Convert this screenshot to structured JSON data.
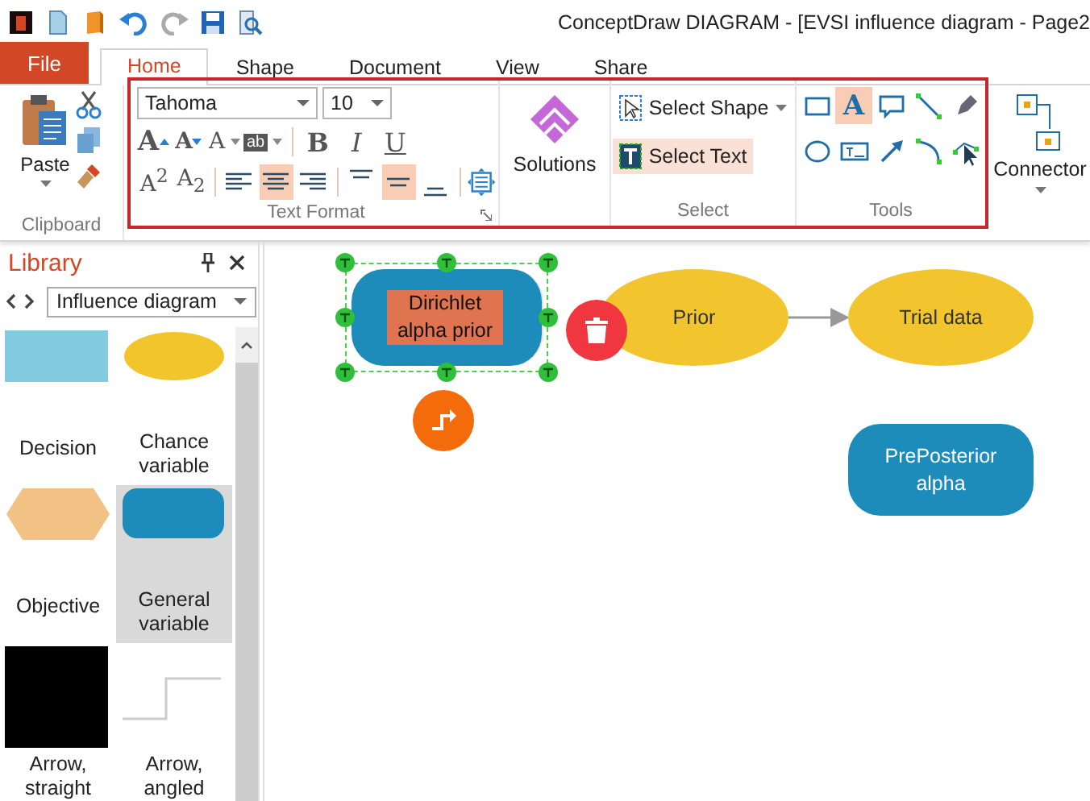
{
  "window": {
    "title": "ConceptDraw DIAGRAM - [EVSI influence diagram - Page2"
  },
  "file_tab": {
    "label": "File"
  },
  "tabs": [
    {
      "label": "Home",
      "selected": true
    },
    {
      "label": "Shape",
      "selected": false
    },
    {
      "label": "Document",
      "selected": false
    },
    {
      "label": "View",
      "selected": false
    },
    {
      "label": "Share",
      "selected": false
    }
  ],
  "ribbon": {
    "clipboard": {
      "paste": "Paste",
      "group_label": "Clipboard"
    },
    "text_format": {
      "font": "Tahoma",
      "size": "10",
      "grow": "A",
      "shrink": "A",
      "font_color": "A",
      "highlight": "ab",
      "styles": [
        {
          "label": "B",
          "kind": "bold"
        },
        {
          "label": "I",
          "kind": "italic"
        },
        {
          "label": "U",
          "kind": "underline"
        }
      ],
      "scripts": [
        "A$^{2}$",
        "A$_{2}$"
      ],
      "h_align": [
        {
          "kind": "left",
          "selected": false
        },
        {
          "kind": "center",
          "selected": true
        },
        {
          "kind": "right",
          "selected": false
        }
      ],
      "v_align": [
        {
          "kind": "top",
          "selected": false
        },
        {
          "kind": "middle",
          "selected": true
        },
        {
          "kind": "bottom",
          "selected": false
        }
      ],
      "group_label": "Text Format"
    },
    "solutions": {
      "label": "Solutions"
    },
    "select": {
      "items": [
        {
          "label": "Select Shape",
          "kind": "shape",
          "selected": false
        },
        {
          "label": "Select Text",
          "kind": "text",
          "selected": true
        }
      ],
      "group_label": "Select"
    },
    "tools": {
      "items": [
        {
          "kind": "rectangle",
          "selected": false
        },
        {
          "kind": "text",
          "label": "A",
          "selected": true
        },
        {
          "kind": "callout",
          "selected": false
        },
        {
          "kind": "line",
          "selected": false
        },
        {
          "kind": "pen",
          "selected": false
        },
        {
          "kind": "ellipse",
          "selected": false
        },
        {
          "kind": "textbox",
          "selected": false
        },
        {
          "kind": "arrow",
          "selected": false
        },
        {
          "kind": "arc",
          "selected": false
        },
        {
          "kind": "edit",
          "selected": false
        }
      ],
      "group_label": "Tools"
    },
    "connector": {
      "label": "Connector"
    }
  },
  "library": {
    "title": "Library",
    "dropdown": "Influence diagram",
    "items": [
      {
        "label": "Decision",
        "kind": "rect",
        "selected": false
      },
      {
        "label": "Chance variable",
        "kind": "ellipse",
        "selected": false
      },
      {
        "label": "Objective",
        "kind": "hexagon",
        "selected": false
      },
      {
        "label": "General variable",
        "kind": "rounded",
        "selected": true
      },
      {
        "label": "Arrow, straight",
        "kind": "black",
        "selected": false
      },
      {
        "label": "Arrow, angled",
        "kind": "angled",
        "selected": false
      }
    ]
  },
  "canvas": {
    "nodes": [
      {
        "text": "Dirichlet alpha prior",
        "kind": "rounded",
        "selected": true
      },
      {
        "text": "Prior",
        "kind": "ellipse",
        "selected": false
      },
      {
        "text": "Trial data",
        "kind": "ellipse",
        "selected": false
      },
      {
        "text": "PrePosterior alpha",
        "kind": "rounded",
        "selected": false
      }
    ]
  }
}
